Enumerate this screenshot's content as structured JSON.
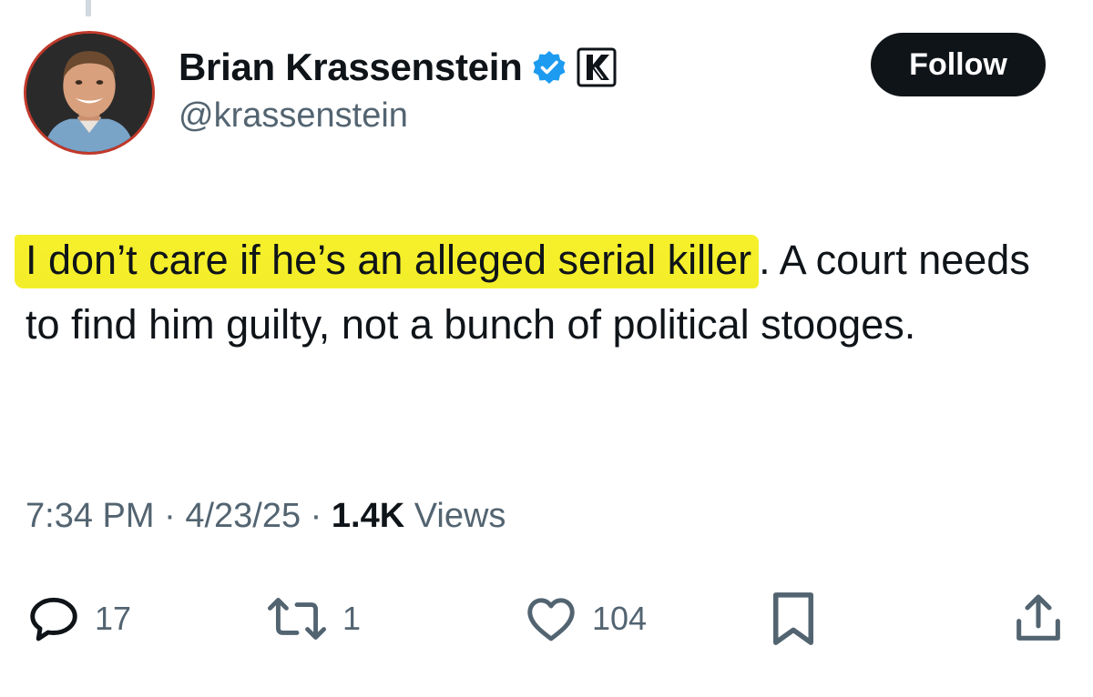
{
  "author": {
    "display_name": "Brian Krassenstein",
    "handle": "@krassenstein",
    "verified_badge_color": "#1d9bf0"
  },
  "follow_button": {
    "label": "Follow"
  },
  "tweet": {
    "highlighted_text": "I don’t care if he’s an alleged serial killer",
    "rest_text": ". A court needs to find him guilty, not a bunch of political stooges.",
    "highlight_color": "#f4ef2b"
  },
  "meta": {
    "time": "7:34 PM",
    "separator": "·",
    "date": "4/23/25",
    "views_count": "1.4K",
    "views_label": "Views"
  },
  "actions": {
    "replies": "17",
    "reposts": "1",
    "likes": "104",
    "icons": [
      "reply-icon",
      "repost-icon",
      "like-icon",
      "bookmark-icon",
      "share-icon"
    ]
  },
  "colors": {
    "text_primary": "#0f1419",
    "text_secondary": "#536471",
    "button_bg": "#0f1419",
    "avatar_ring": "#c0392b"
  }
}
